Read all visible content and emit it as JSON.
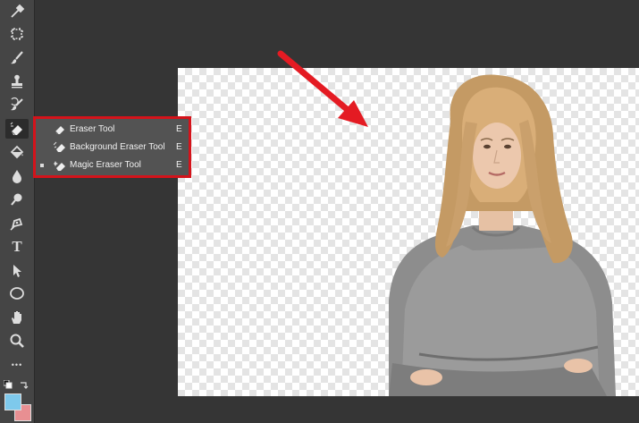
{
  "toolbar": {
    "tools": [
      {
        "icon": "eyedropper-icon"
      },
      {
        "icon": "crop-icon"
      },
      {
        "icon": "brush-icon"
      },
      {
        "icon": "stamp-icon"
      },
      {
        "icon": "history-brush-icon"
      },
      {
        "icon": "eraser-icon",
        "active": true
      },
      {
        "icon": "paint-bucket-icon"
      },
      {
        "icon": "blur-drop-icon"
      },
      {
        "icon": "dodge-icon"
      },
      {
        "icon": "pen-icon"
      },
      {
        "icon": "type-icon",
        "text": "T"
      },
      {
        "icon": "path-select-icon"
      },
      {
        "icon": "ellipse-icon"
      },
      {
        "icon": "hand-icon"
      },
      {
        "icon": "zoom-icon"
      },
      {
        "icon": "more-icon",
        "text": "•••"
      }
    ],
    "foreground_color": "#7ec9ec",
    "background_color": "#e88f92"
  },
  "flyout": {
    "items": [
      {
        "label": "Eraser Tool",
        "shortcut": "E",
        "icon": "eraser-icon",
        "selected": false
      },
      {
        "label": "Background Eraser Tool",
        "shortcut": "E",
        "icon": "background-eraser-icon",
        "selected": false
      },
      {
        "label": "Magic Eraser Tool",
        "shortcut": "E",
        "icon": "magic-eraser-icon",
        "selected": true
      }
    ],
    "highlight_color": "#d4131b"
  },
  "annotation": {
    "arrow_color": "#e41b23"
  },
  "canvas": {
    "content": "photo-of-woman-on-transparent-background"
  }
}
